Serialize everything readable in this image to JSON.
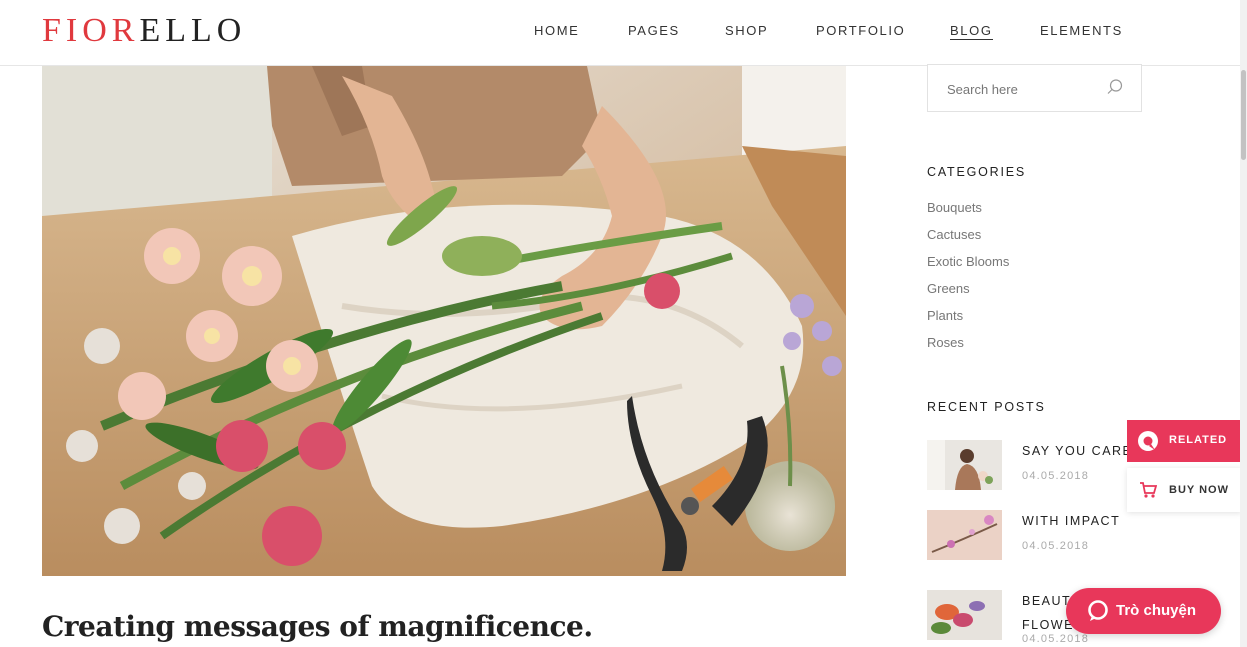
{
  "brand": {
    "logo_accent": "FIOR",
    "logo_rest": "ELLO",
    "accent_color": "#e0393e"
  },
  "nav": {
    "items": [
      {
        "label": "HOME"
      },
      {
        "label": "PAGES"
      },
      {
        "label": "SHOP"
      },
      {
        "label": "PORTFOLIO"
      },
      {
        "label": "BLOG",
        "active": true
      },
      {
        "label": "ELEMENTS"
      }
    ]
  },
  "post": {
    "title": "Creating messages of magnificence."
  },
  "sidebar": {
    "search": {
      "placeholder": "Search here",
      "icon": "search-icon"
    },
    "categories": {
      "title": "CATEGORIES",
      "items": [
        "Bouquets",
        "Cactuses",
        "Exotic Blooms",
        "Greens",
        "Plants",
        "Roses"
      ]
    },
    "recent_posts": {
      "title": "RECENT POSTS",
      "items": [
        {
          "title": "SAY YOU CARE",
          "date": "04.05.2018"
        },
        {
          "title": "WITH IMPACT",
          "date": "04.05.2018"
        },
        {
          "title": "BEAUTIFUL",
          "title_line2": "FLOWERS",
          "date": "04.05.2018"
        }
      ]
    }
  },
  "floating": {
    "related_label": "RELATED",
    "buy_now_label": "BUY NOW",
    "chat_label": "Trò chuyện",
    "pink": "#e8375a"
  }
}
